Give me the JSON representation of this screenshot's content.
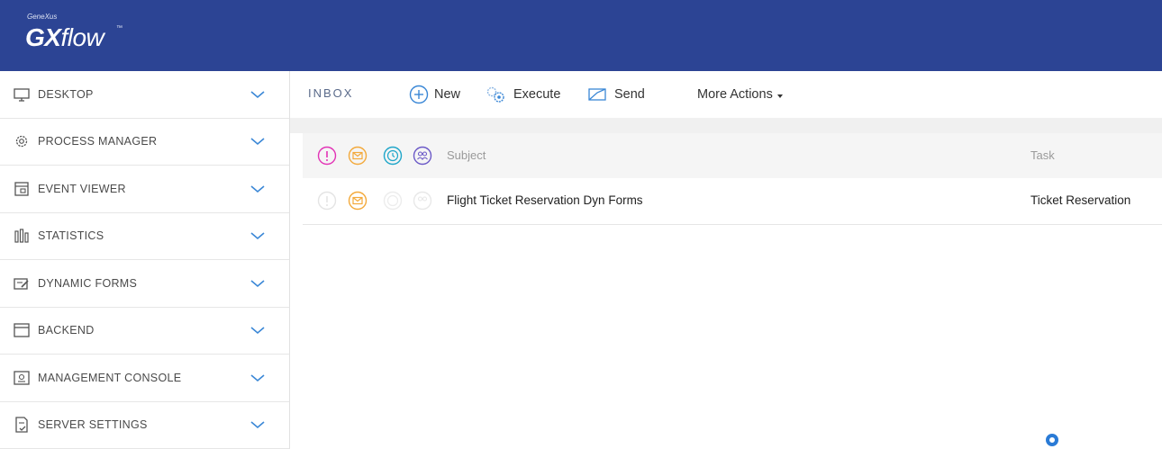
{
  "header": {
    "brand_small": "GeneXus",
    "brand_gx": "GX",
    "brand_flow": "flow",
    "brand_tm": "™"
  },
  "sidebar": {
    "items": [
      {
        "label": "DESKTOP",
        "icon": "monitor-icon"
      },
      {
        "label": "PROCESS MANAGER",
        "icon": "gear-icon"
      },
      {
        "label": "EVENT VIEWER",
        "icon": "calendar-icon"
      },
      {
        "label": "STATISTICS",
        "icon": "bar-chart-icon"
      },
      {
        "label": "DYNAMIC FORMS",
        "icon": "form-edit-icon"
      },
      {
        "label": "BACKEND",
        "icon": "window-icon"
      },
      {
        "label": "MANAGEMENT CONSOLE",
        "icon": "console-icon"
      },
      {
        "label": "SERVER SETTINGS",
        "icon": "document-check-icon"
      }
    ]
  },
  "toolbar": {
    "title": "INBOX",
    "new_label": "New",
    "execute_label": "Execute",
    "send_label": "Send",
    "more_label": "More Actions"
  },
  "table": {
    "headers": {
      "subject": "Subject",
      "task": "Task"
    },
    "rows": [
      {
        "subject": "Flight Ticket Reservation Dyn Forms",
        "task": "Ticket Reservation"
      }
    ]
  },
  "colors": {
    "header_bg": "#2c4494",
    "priority": "#e233b6",
    "message": "#f3a93b",
    "deadline": "#1fa6c9",
    "participants": "#6b59c7",
    "toolbar_icon": "#3a87d6"
  }
}
